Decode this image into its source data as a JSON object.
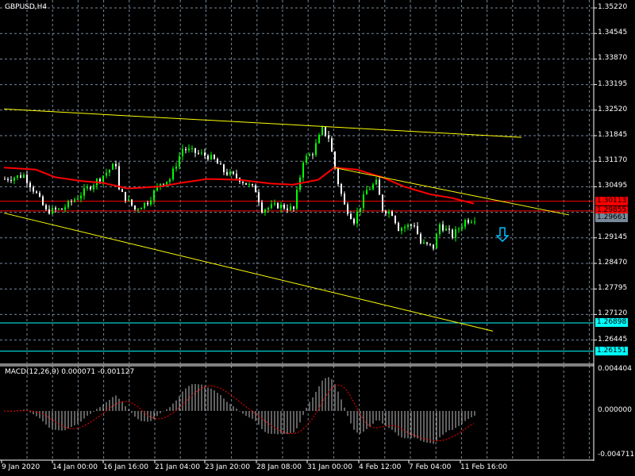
{
  "header": {
    "symbol_label": "GBPUSD,H4"
  },
  "macd": {
    "label": "MACD(12,26,9) 0.000071 -0.001127",
    "scale": [
      "0.004404",
      "0.000000",
      "-0.004711"
    ]
  },
  "price_axis": [
    "1.35220",
    "1.34545",
    "1.33870",
    "1.33195",
    "1.32520",
    "1.31845",
    "1.31170",
    "1.30495",
    "1.29145",
    "1.28470",
    "1.27795",
    "1.27120",
    "1.26445"
  ],
  "levels": [
    {
      "price": 1.30113,
      "label": "1.30113",
      "color": "#ff0000",
      "text": "#000000"
    },
    {
      "price": 1.29855,
      "label": "1.29855",
      "color": "#ff0000",
      "text": "#000000"
    },
    {
      "price": 1.29661,
      "label": "1.29661",
      "color": "#778899",
      "text": "#000000"
    },
    {
      "price": 1.26898,
      "label": "1.26898",
      "color": "#00ffff",
      "text": "#000000"
    },
    {
      "price": 1.26151,
      "label": "1.26151",
      "color": "#00ffff",
      "text": "#000000"
    }
  ],
  "time_axis": [
    "9 Jan 2020",
    "14 Jan 00:00",
    "16 Jan 16:00",
    "21 Jan 04:00",
    "23 Jan 20:00",
    "28 Jan 08:00",
    "31 Jan 00:00",
    "4 Feb 12:00",
    "7 Feb 04:00",
    "11 Feb 16:00"
  ],
  "colors": {
    "bull": "#00ff00",
    "bear": "#ffffff",
    "ma": "#ff0000",
    "trend": "#ffff00",
    "grid": "#778899",
    "arrow": "#00bfff"
  },
  "chart_data": {
    "type": "candlestick",
    "symbol": "GBPUSD",
    "timeframe": "H4",
    "ylim": [
      1.258,
      1.354
    ],
    "close_path": [
      [
        0,
        1.307
      ],
      [
        6,
        1.308
      ],
      [
        10,
        1.303
      ],
      [
        13,
        1.2985
      ],
      [
        18,
        1.299
      ],
      [
        24,
        1.303
      ],
      [
        31,
        1.308
      ],
      [
        35,
        1.311
      ],
      [
        36,
        1.304
      ],
      [
        41,
        1.299
      ],
      [
        45,
        1.301
      ],
      [
        49,
        1.306
      ],
      [
        52,
        1.307
      ],
      [
        56,
        1.315
      ],
      [
        60,
        1.314
      ],
      [
        64,
        1.313
      ],
      [
        66,
        1.312
      ],
      [
        69,
        1.309
      ],
      [
        74,
        1.307
      ],
      [
        79,
        1.304
      ],
      [
        81,
        1.299
      ],
      [
        86,
        1.3
      ],
      [
        91,
        1.299
      ],
      [
        94,
        1.312
      ],
      [
        97,
        1.314
      ],
      [
        100,
        1.32
      ],
      [
        102,
        1.318
      ],
      [
        105,
        1.306
      ],
      [
        107,
        1.3
      ],
      [
        110,
        1.296
      ],
      [
        114,
        1.304
      ],
      [
        117,
        1.306
      ],
      [
        119,
        1.299
      ],
      [
        122,
        1.298
      ],
      [
        124,
        1.294
      ],
      [
        129,
        1.295
      ],
      [
        131,
        1.29
      ],
      [
        135,
        1.289
      ],
      [
        137,
        1.295
      ],
      [
        141,
        1.292
      ],
      [
        145,
        1.296
      ],
      [
        148,
        1.2966
      ]
    ],
    "ma_path": [
      [
        0,
        1.31
      ],
      [
        10,
        1.3095
      ],
      [
        16,
        1.3075
      ],
      [
        24,
        1.3065
      ],
      [
        31,
        1.306
      ],
      [
        39,
        1.3045
      ],
      [
        49,
        1.305
      ],
      [
        56,
        1.306
      ],
      [
        64,
        1.307
      ],
      [
        74,
        1.3068
      ],
      [
        84,
        1.3058
      ],
      [
        91,
        1.3055
      ],
      [
        99,
        1.3068
      ],
      [
        104,
        1.31
      ],
      [
        111,
        1.3095
      ],
      [
        119,
        1.3075
      ],
      [
        126,
        1.305
      ],
      [
        134,
        1.303
      ],
      [
        141,
        1.302
      ],
      [
        148,
        1.3005
      ]
    ],
    "trendlines": [
      [
        [
          0,
          1.3255
        ],
        [
          163,
          1.318
        ]
      ],
      [
        [
          104,
          1.31
        ],
        [
          178,
          1.2975
        ]
      ],
      [
        [
          0,
          1.298
        ],
        [
          154,
          1.2668
        ]
      ]
    ],
    "signal_arrow": {
      "bar": 157,
      "price": 1.292,
      "direction": "down"
    }
  }
}
